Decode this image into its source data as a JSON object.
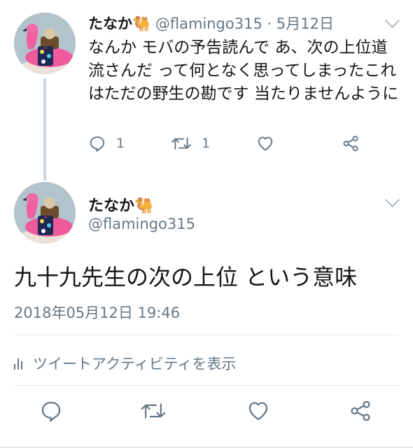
{
  "reply": {
    "display_name": "たなか🐫",
    "handle": "@flamingo315",
    "separator": "·",
    "date": "5月12日",
    "text": "なんか モバの予告読んで あ、次の上位道流さんだ って何となく思ってしまったこれはただの野生の勘です 当たりませんように",
    "reply_count": "1",
    "retweet_count": "1"
  },
  "main_tweet": {
    "display_name": "たなか🐫",
    "handle": "@flamingo315",
    "text": "九十九先生の次の上位 という意味",
    "timestamp": "2018年05月12日 19:46",
    "activity_label": "ツイートアクティビティを表示"
  },
  "icons": {
    "reply": "reply-icon",
    "retweet": "retweet-icon",
    "like": "heart-icon",
    "share": "share-icon",
    "menu": "chevron-down-icon",
    "activity": "bar-chart-icon"
  },
  "colors": {
    "icon_gray": "#657786",
    "text": "#14171a",
    "divider": "#e1e8ed",
    "thread_line": "#ccd6dd"
  }
}
